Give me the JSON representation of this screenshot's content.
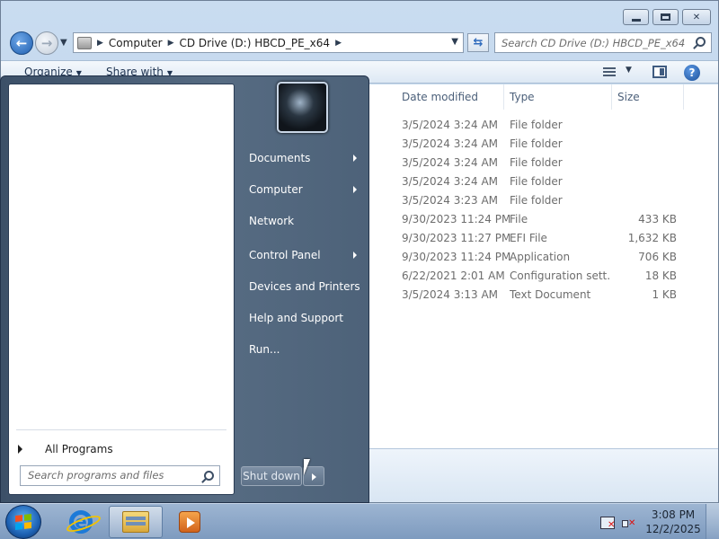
{
  "explorer": {
    "breadcrumb": [
      "Computer",
      "CD Drive (D:) HBCD_PE_x64"
    ],
    "search_placeholder": "Search CD Drive (D:) HBCD_PE_x64",
    "toolbar": {
      "organize": "Organize",
      "share_with": "Share with"
    },
    "columns": {
      "date_modified": "Date modified",
      "type": "Type",
      "size": "Size"
    },
    "files": [
      {
        "date": "3/5/2024 3:24 AM",
        "type": "File folder",
        "size": ""
      },
      {
        "date": "3/5/2024 3:24 AM",
        "type": "File folder",
        "size": ""
      },
      {
        "date": "3/5/2024 3:24 AM",
        "type": "File folder",
        "size": ""
      },
      {
        "date": "3/5/2024 3:24 AM",
        "type": "File folder",
        "size": ""
      },
      {
        "date": "3/5/2024 3:23 AM",
        "type": "File folder",
        "size": ""
      },
      {
        "date": "9/30/2023 11:24 PM",
        "type": "File",
        "size": "433 KB"
      },
      {
        "date": "9/30/2023 11:27 PM",
        "type": "EFI File",
        "size": "1,632 KB"
      },
      {
        "date": "9/30/2023 11:24 PM",
        "type": "Application",
        "size": "706 KB"
      },
      {
        "date": "6/22/2021 2:01 AM",
        "type": "Configuration sett...",
        "size": "18 KB"
      },
      {
        "date": "3/5/2024 3:13 AM",
        "type": "Text Document",
        "size": "1 KB"
      }
    ]
  },
  "start_menu": {
    "all_programs": "All Programs",
    "search_placeholder": "Search programs and files",
    "right_items": [
      {
        "label": "Documents",
        "submenu": true
      },
      {
        "label": "Computer",
        "submenu": true
      },
      {
        "label": "Network",
        "submenu": false
      },
      {
        "label": "Control Panel",
        "submenu": true
      },
      {
        "label": "Devices and Printers",
        "submenu": false
      },
      {
        "label": "Help and Support",
        "submenu": false
      },
      {
        "label": "Run...",
        "submenu": false
      }
    ],
    "shutdown_label": "Shut down"
  },
  "taskbar": {
    "pinned": [
      "start-orb",
      "internet-explorer-icon",
      "windows-explorer-icon",
      "media-player-icon"
    ],
    "clock": {
      "time": "3:08 PM",
      "date": "12/2/2025"
    }
  },
  "colors": {
    "start_menu_panel": "#4d6279",
    "taskbar": "#8fa9c9",
    "accent_blue": "#1f5fb0"
  }
}
